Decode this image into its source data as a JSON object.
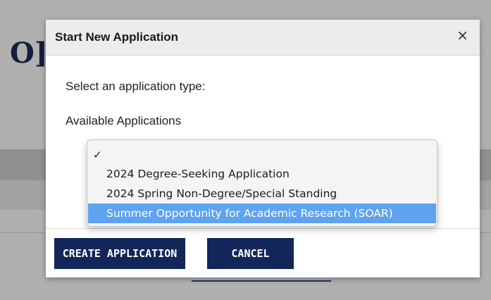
{
  "background": {
    "heading_partial": "O]"
  },
  "modal": {
    "title": "Start New Application",
    "close_glyph": "×",
    "prompt": "Select an application type:",
    "available_label": "Available Applications"
  },
  "select": {
    "check_glyph": "✓",
    "options": [
      {
        "label": "",
        "checked": true
      },
      {
        "label": "2024 Degree-Seeking Application"
      },
      {
        "label": "2024 Spring Non-Degree/Special Standing"
      },
      {
        "label": "Summer Opportunity for Academic Research (SOAR)",
        "highlighted": true
      }
    ]
  },
  "actions": {
    "create_label": "CREATE APPLICATION",
    "cancel_label": "CANCEL"
  },
  "colors": {
    "primary_button": "#13265a",
    "highlight": "#5fa3ee"
  }
}
